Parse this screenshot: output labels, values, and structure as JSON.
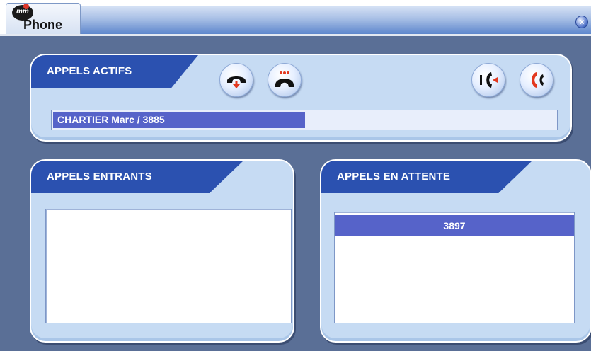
{
  "app": {
    "title": "Phone",
    "logo_text": "mm"
  },
  "window": {
    "close_symbol": "x"
  },
  "active_calls": {
    "title": "APPELS ACTIFS",
    "rows": [
      {
        "label": "CHARTIER Marc / 3885"
      }
    ],
    "buttons": [
      {
        "name": "hangup-button",
        "icon": "hangup-icon"
      },
      {
        "name": "hold-button",
        "icon": "phone-hold-icon"
      },
      {
        "name": "transfer-button",
        "icon": "transfer-icon"
      },
      {
        "name": "conference-button",
        "icon": "conference-icon"
      }
    ]
  },
  "incoming_calls": {
    "title": "APPELS ENTRANTS",
    "rows": []
  },
  "waiting_calls": {
    "title": "APPELS EN ATTENTE",
    "rows": [
      {
        "label": "3897"
      }
    ]
  },
  "colors": {
    "window_bg": "#5a6f96",
    "panel_bg": "#c6dbf3",
    "header_blue": "#2b51b0",
    "selection": "#5663c9",
    "icon_red": "#e3381f"
  }
}
